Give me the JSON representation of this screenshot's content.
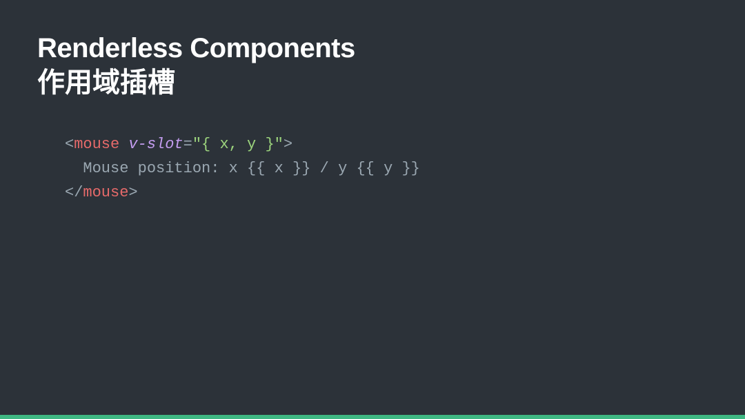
{
  "slide": {
    "title_en": "Renderless Components",
    "title_zh": "作用域插槽",
    "code": {
      "line1": {
        "open_bracket": "<",
        "tag_open": "mouse",
        "space1": " ",
        "attr": "v-slot",
        "eq": "=",
        "string": "\"{ x, y }\"",
        "close_bracket": ">"
      },
      "line2": {
        "text": "  Mouse position: x {{ x }} / y {{ y }}"
      },
      "line3": {
        "open_bracket": "</",
        "tag_close": "mouse",
        "close_bracket": ">"
      }
    }
  }
}
